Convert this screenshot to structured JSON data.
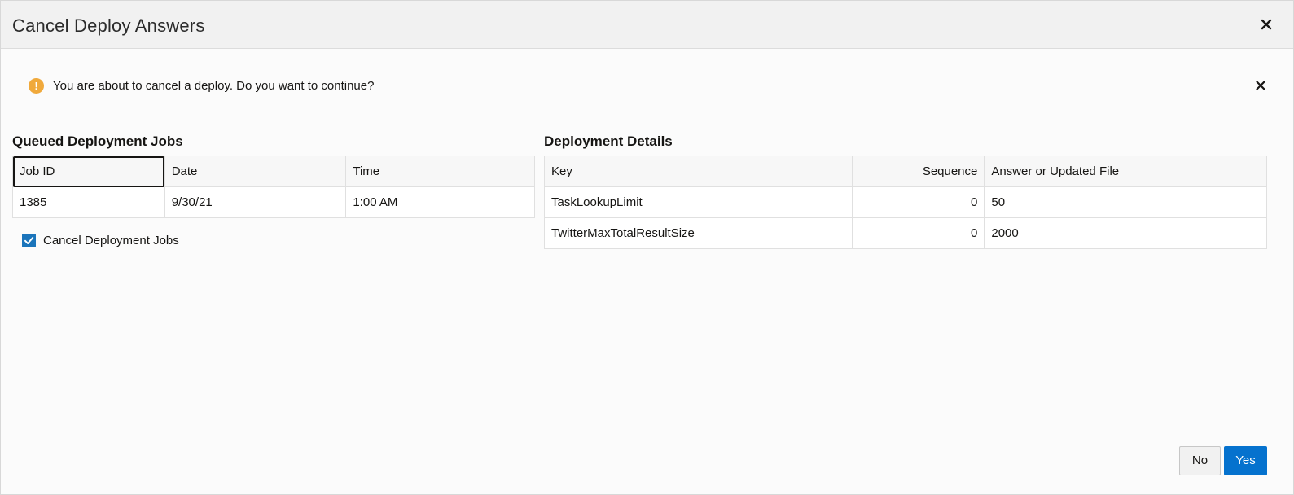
{
  "dialog": {
    "title": "Cancel Deploy Answers",
    "close_icon": "close-icon"
  },
  "banner": {
    "icon": "warning-icon",
    "icon_glyph": "!",
    "message": "You are about to cancel a deploy. Do you want to continue?",
    "close_icon": "close-icon"
  },
  "queued_jobs": {
    "title": "Queued Deployment Jobs",
    "columns": [
      "Job ID",
      "Date",
      "Time"
    ],
    "rows": [
      [
        "1385",
        "9/30/21",
        "1:00 AM"
      ]
    ]
  },
  "cancel_checkbox": {
    "label": "Cancel Deployment Jobs",
    "checked": true
  },
  "deployment_details": {
    "title": "Deployment Details",
    "columns": [
      "Key",
      "Sequence",
      "Answer or Updated File"
    ],
    "rows": [
      [
        "TaskLookupLimit",
        "0",
        "50"
      ],
      [
        "TwitterMaxTotalResultSize",
        "0",
        "2000"
      ]
    ]
  },
  "buttons": {
    "no": "No",
    "yes": "Yes"
  },
  "colors": {
    "primary": "#0572ce",
    "warning": "#f0a93b",
    "checkbox": "#1b75bb"
  }
}
